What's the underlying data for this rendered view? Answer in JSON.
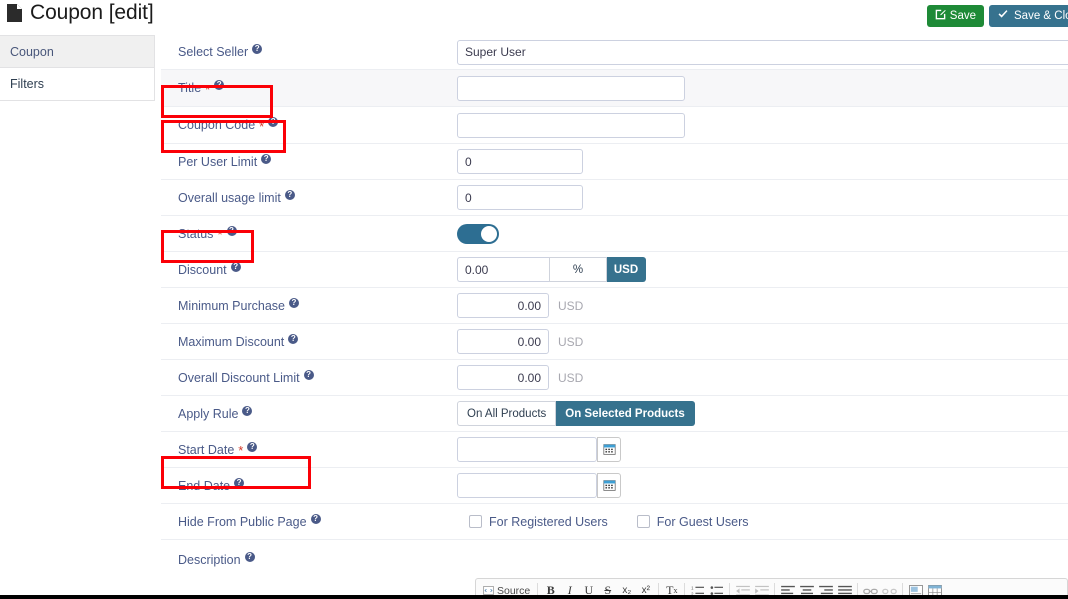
{
  "header": {
    "title": "Coupon [edit]",
    "doc_icon": "document-icon",
    "save_label": "Save",
    "save_icon": "edit-pencil-icon",
    "save_close_label": "Save & Clos",
    "save_close_icon": "check-icon",
    "save_color": "#1e8a37",
    "save_close_color": "#36728e"
  },
  "sidebar": {
    "items": [
      {
        "label": "Coupon",
        "active": true
      },
      {
        "label": "Filters",
        "active": false
      }
    ]
  },
  "form": {
    "help_glyph": "?",
    "required_glyph": "*",
    "rows": {
      "select_seller": {
        "label": "Select Seller",
        "value": "Super User"
      },
      "title": {
        "label": "Title",
        "value": ""
      },
      "coupon_code": {
        "label": "Coupon Code",
        "value": ""
      },
      "per_user_limit": {
        "label": "Per User Limit",
        "value": "0"
      },
      "overall_usage_limit": {
        "label": "Overall usage limit",
        "value": "0"
      },
      "status": {
        "label": "Status",
        "toggle_on": true
      },
      "discount": {
        "label": "Discount",
        "value": "0.00",
        "units": [
          {
            "label": "%",
            "selected": false
          },
          {
            "label": "USD",
            "selected": true
          }
        ]
      },
      "minimum_purchase": {
        "label": "Minimum Purchase",
        "value": "0.00",
        "unit": "USD"
      },
      "maximum_discount": {
        "label": "Maximum Discount",
        "value": "0.00",
        "unit": "USD"
      },
      "overall_discount_limit": {
        "label": "Overall Discount Limit",
        "value": "0.00",
        "unit": "USD"
      },
      "apply_rule": {
        "label": "Apply Rule",
        "options": [
          {
            "label": "On All Products",
            "selected": false
          },
          {
            "label": "On Selected Products",
            "selected": true
          }
        ]
      },
      "start_date": {
        "label": "Start Date",
        "value": "",
        "icon": "calendar-icon"
      },
      "end_date": {
        "label": "End Date",
        "value": "",
        "icon": "calendar-icon"
      },
      "hide_from_public_page": {
        "label": "Hide From Public Page",
        "checkboxes": [
          {
            "label": "For Registered Users",
            "checked": false
          },
          {
            "label": "For Guest Users",
            "checked": false
          }
        ]
      },
      "description": {
        "label": "Description"
      }
    }
  },
  "editor": {
    "source_label": "Source",
    "buttons": [
      "B",
      "I",
      "U",
      "S",
      "x₂",
      "x²",
      "Tx"
    ]
  },
  "annotations": {
    "color": "#fb0007",
    "boxes": [
      "title",
      "coupon-code",
      "status",
      "start-date"
    ]
  }
}
